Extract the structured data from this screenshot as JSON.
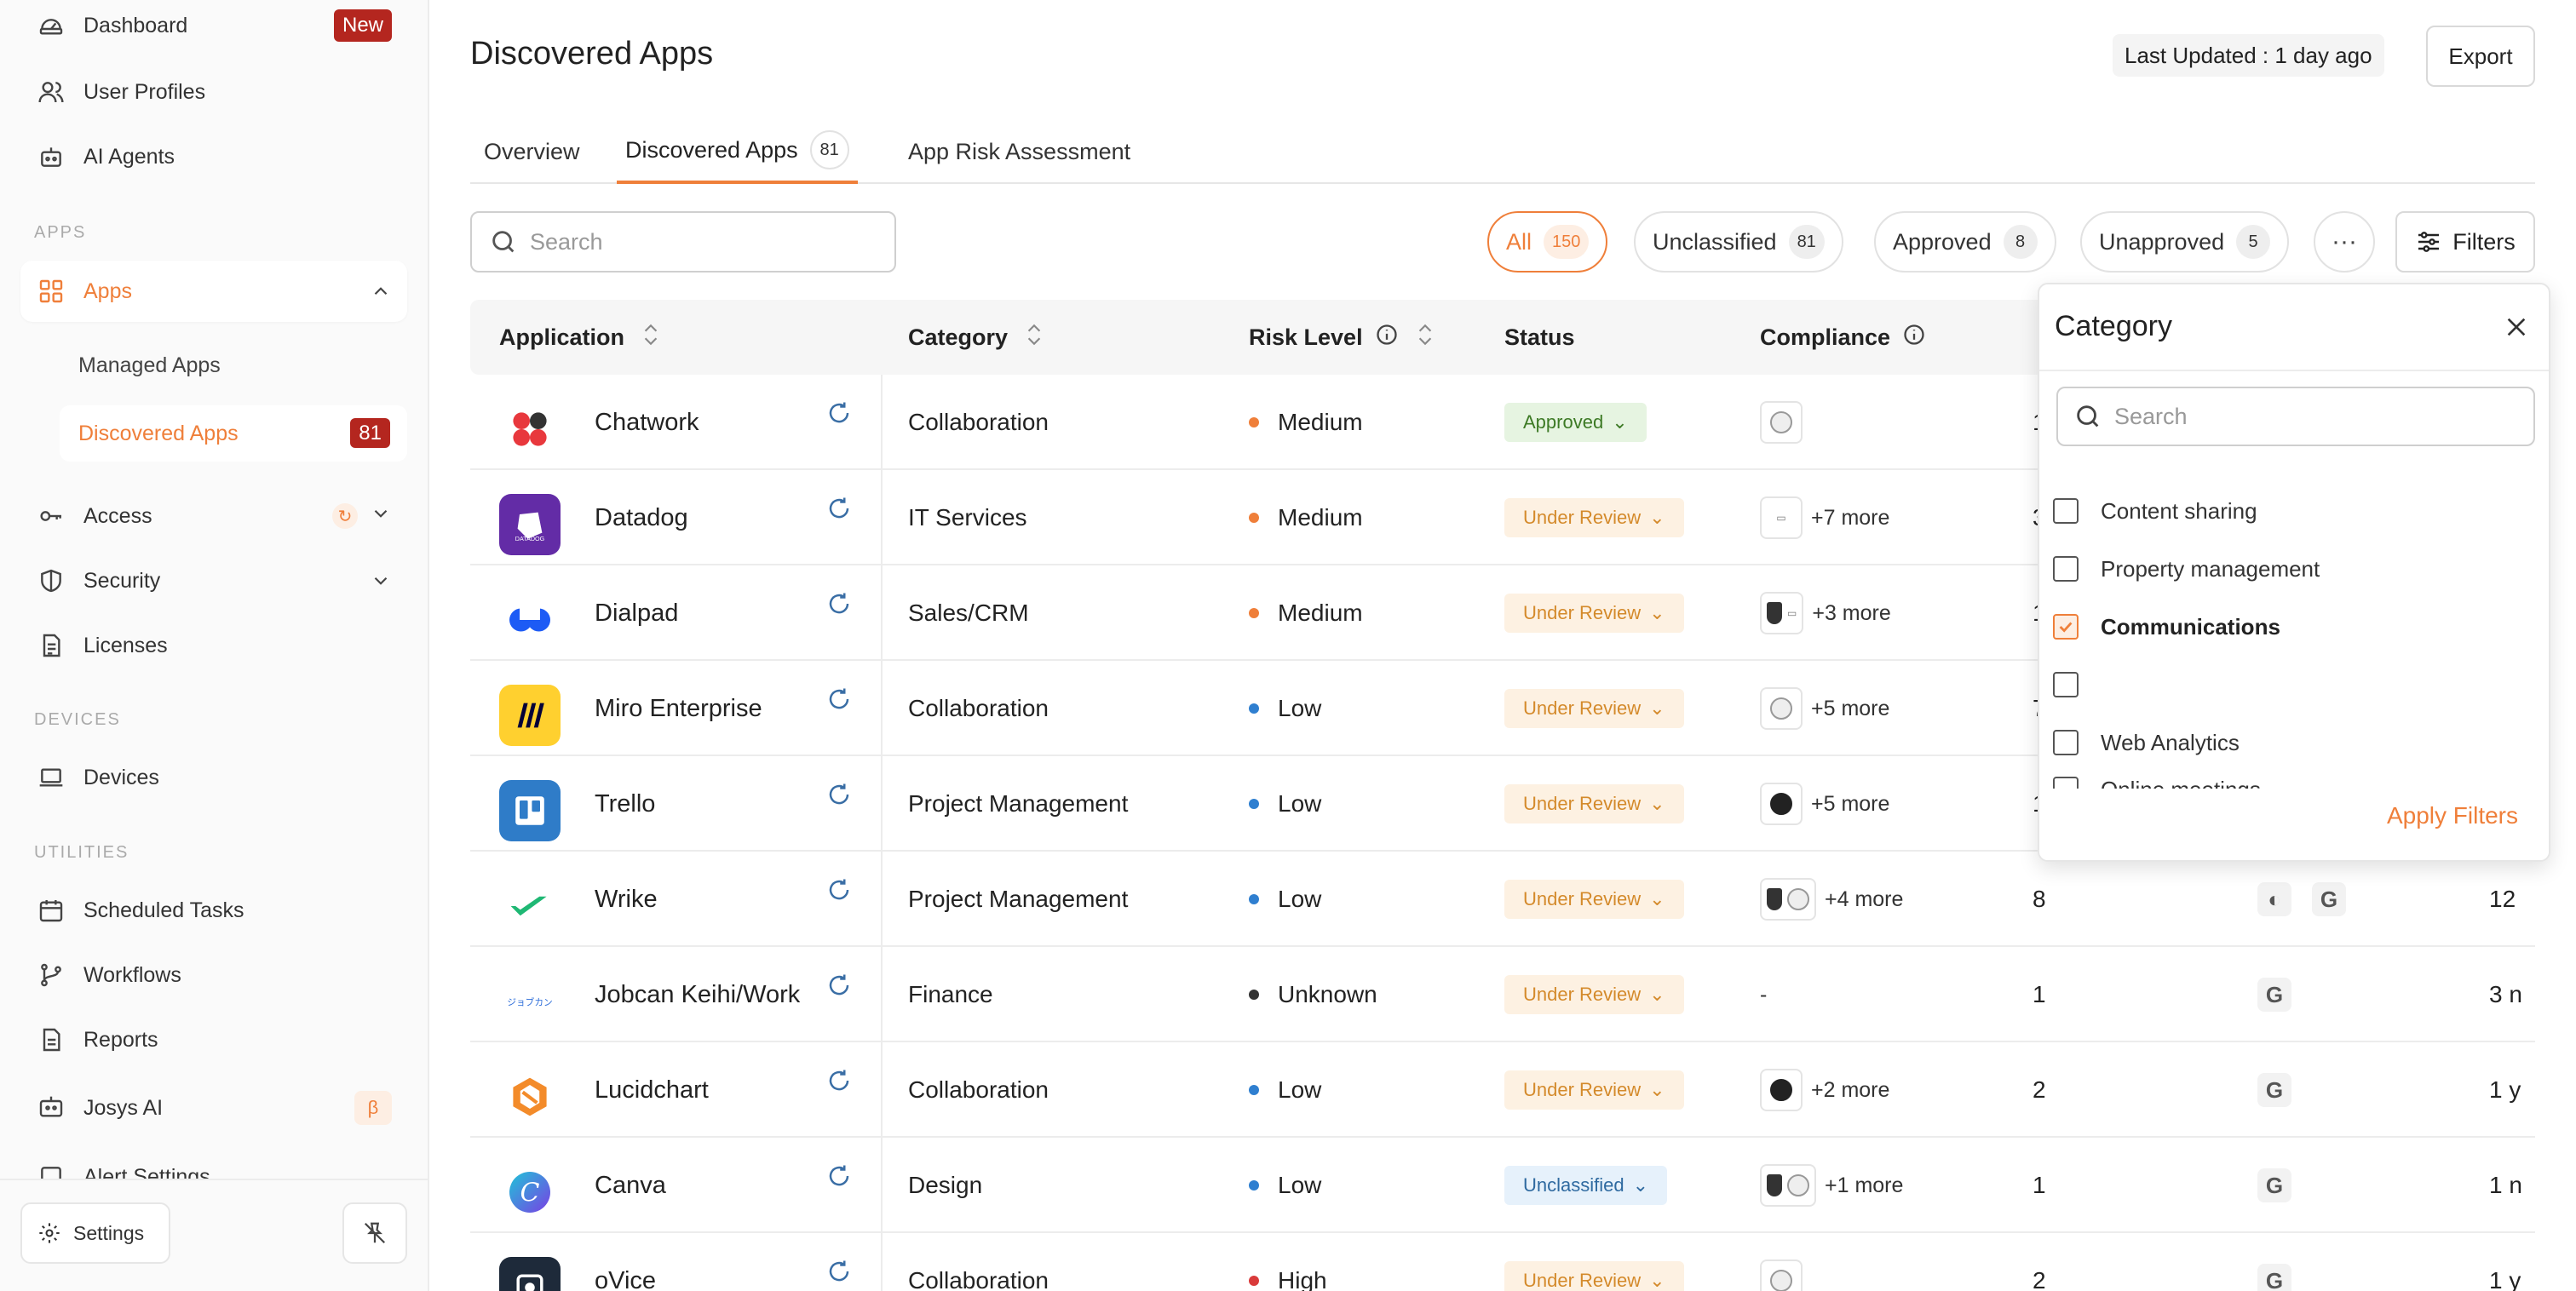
{
  "sidebar": {
    "top_items": [
      {
        "label": "Dashboard",
        "badge": "New"
      },
      {
        "label": "User Profiles"
      },
      {
        "label": "AI Agents"
      }
    ],
    "sections": {
      "apps": "APPS",
      "devices": "DEVICES",
      "utilities": "UTILITIES"
    },
    "apps": {
      "label": "Apps",
      "children": [
        {
          "label": "Managed Apps"
        },
        {
          "label": "Discovered Apps",
          "badge": "81"
        }
      ]
    },
    "access": "Access",
    "security": "Security",
    "licenses": "Licenses",
    "devices": "Devices",
    "utilities": [
      "Scheduled Tasks",
      "Workflows",
      "Reports",
      "Josys AI",
      "Alert Settings"
    ],
    "josys_badge": "β",
    "settings": "Settings"
  },
  "header": {
    "title": "Discovered Apps",
    "last_updated": "Last Updated : 1 day ago",
    "export": "Export"
  },
  "tabs": [
    {
      "label": "Overview"
    },
    {
      "label": "Discovered Apps",
      "count": "81",
      "active": true
    },
    {
      "label": "App Risk Assessment"
    }
  ],
  "search": {
    "placeholder": "Search"
  },
  "filter_pills": [
    {
      "label": "All",
      "count": "150",
      "active": true
    },
    {
      "label": "Unclassified",
      "count": "81"
    },
    {
      "label": "Approved",
      "count": "8"
    },
    {
      "label": "Unapproved",
      "count": "5"
    }
  ],
  "more_label": "···",
  "filters_label": "Filters",
  "table": {
    "columns": [
      "Application",
      "Category",
      "Risk Level",
      "Status",
      "Compliance"
    ],
    "rows": [
      {
        "app": "Chatwork",
        "category": "Collaboration",
        "risk": "Medium",
        "status": "Approved",
        "compliance_more": "",
        "users": "1",
        "last": ""
      },
      {
        "app": "Datadog",
        "category": "IT Services",
        "risk": "Medium",
        "status": "Under Review",
        "compliance_more": "+7 more",
        "users": "3",
        "last": ""
      },
      {
        "app": "Dialpad",
        "category": "Sales/CRM",
        "risk": "Medium",
        "status": "Under Review",
        "compliance_more": "+3 more",
        "users": "1",
        "last": ""
      },
      {
        "app": "Miro Enterprise",
        "category": "Collaboration",
        "risk": "Low",
        "status": "Under Review",
        "compliance_more": "+5 more",
        "users": "7",
        "last": ""
      },
      {
        "app": "Trello",
        "category": "Project Management",
        "risk": "Low",
        "status": "Under Review",
        "compliance_more": "+5 more",
        "users": "1",
        "last": ""
      },
      {
        "app": "Wrike",
        "category": "Project Management",
        "risk": "Low",
        "status": "Under Review",
        "compliance_more": "+4 more",
        "users": "8",
        "last": "12"
      },
      {
        "app": "Jobcan Keihi/Work",
        "category": "Finance",
        "risk": "Unknown",
        "status": "Under Review",
        "compliance_more": "-",
        "users": "1",
        "last": "3 n"
      },
      {
        "app": "Lucidchart",
        "category": "Collaboration",
        "risk": "Low",
        "status": "Under Review",
        "compliance_more": "+2 more",
        "users": "2",
        "last": "1 y"
      },
      {
        "app": "Canva",
        "category": "Design",
        "risk": "Low",
        "status": "Unclassified",
        "compliance_more": "+1 more",
        "users": "1",
        "last": "1 n"
      },
      {
        "app": "oVice",
        "category": "Collaboration",
        "risk": "High",
        "status": "Under Review",
        "compliance_more": "",
        "users": "2",
        "last": "1 y"
      }
    ]
  },
  "category_popover": {
    "title": "Category",
    "search_placeholder": "Search",
    "options": [
      {
        "label": "Content sharing",
        "checked": false
      },
      {
        "label": "Property management",
        "checked": false
      },
      {
        "label": "Communications",
        "checked": true
      },
      {
        "label": "",
        "checked": false
      },
      {
        "label": "Web Analytics",
        "checked": false
      },
      {
        "label": "Online meetings",
        "checked": false
      }
    ],
    "apply": "Apply Filters"
  },
  "colors": {
    "accent": "#ef7f3a",
    "risk_medium": "#ef7f3a",
    "risk_low": "#2f7fd0",
    "risk_unknown": "#333333",
    "risk_high": "#d93a3a",
    "badge_red": "#b4261f"
  }
}
